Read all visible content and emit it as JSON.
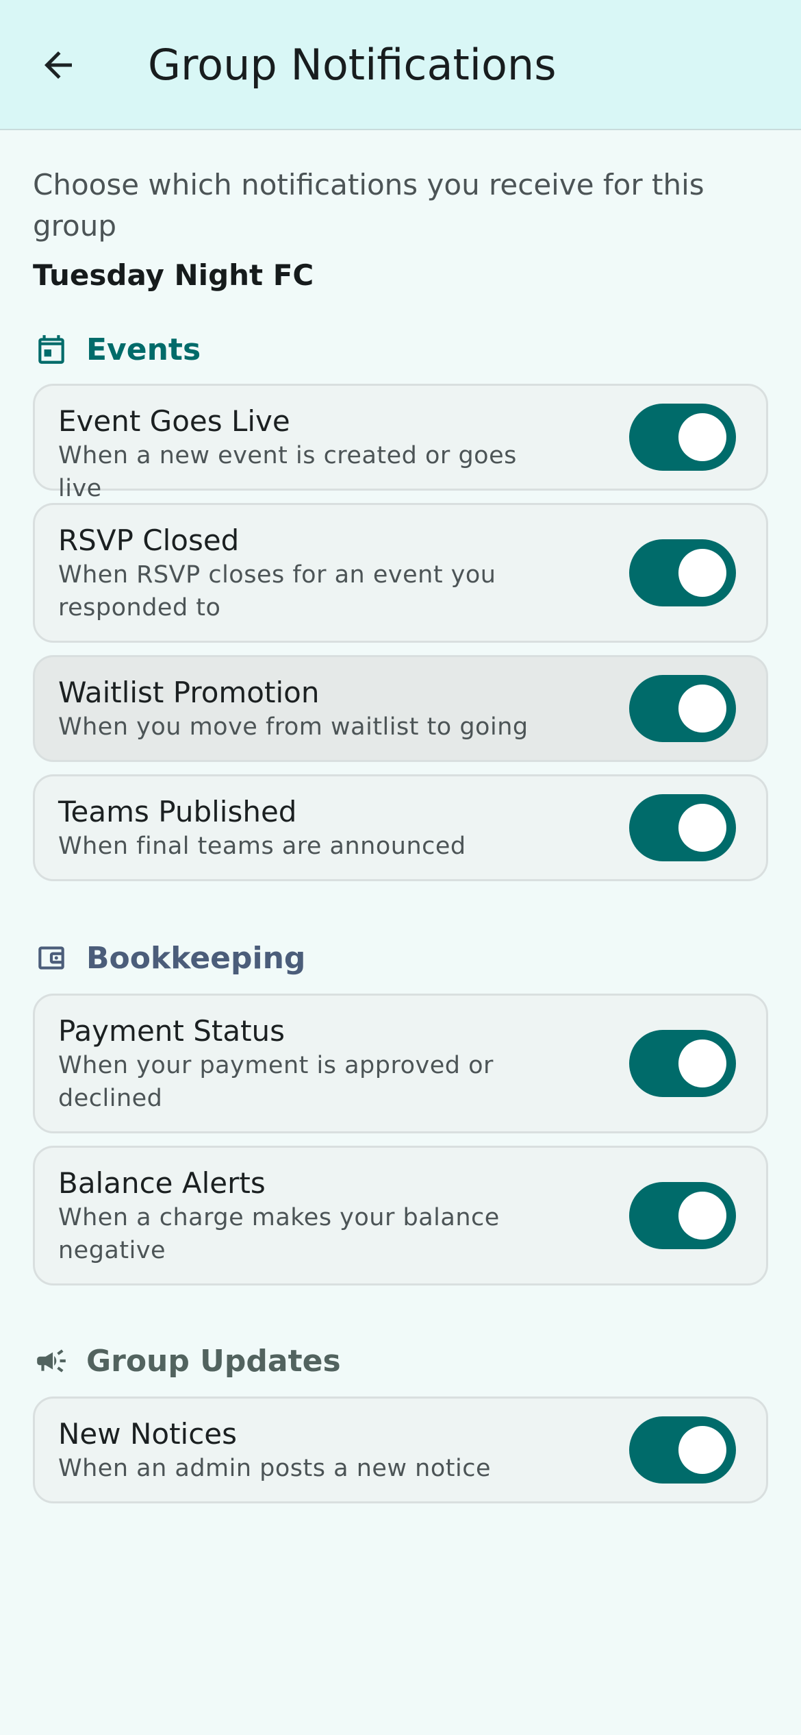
{
  "appbar": {
    "title": "Group Notifications",
    "back_icon": "arrow-left-icon"
  },
  "intro": {
    "description": "Choose which notifications you receive for this group",
    "group_name": "Tuesday Night FC"
  },
  "colors": {
    "appbar_bg": "#d9f7f6",
    "page_bg": "#f1faf9",
    "toggle_on": "#006b6a",
    "events_accent": "#016b6a",
    "bookkeeping_accent": "#4b5d7a",
    "group_updates_accent": "#52635f"
  },
  "sections": [
    {
      "label": "Events",
      "icon": "calendar-icon",
      "items": [
        {
          "title": "Event Goes Live",
          "subtitle": "When a new event is created or goes live",
          "enabled": true
        },
        {
          "title": "RSVP Closed",
          "subtitle": "When RSVP closes for an event you responded to",
          "enabled": true
        },
        {
          "title": "Waitlist Promotion",
          "subtitle": "When you move from waitlist to going",
          "enabled": true
        },
        {
          "title": "Teams Published",
          "subtitle": "When final teams are announced",
          "enabled": true
        }
      ]
    },
    {
      "label": "Bookkeeping",
      "icon": "wallet-icon",
      "items": [
        {
          "title": "Payment Status",
          "subtitle": "When your payment is approved or declined",
          "enabled": true
        },
        {
          "title": "Balance Alerts",
          "subtitle": "When a charge makes your balance negative",
          "enabled": true
        }
      ]
    },
    {
      "label": "Group Updates",
      "icon": "megaphone-icon",
      "items": [
        {
          "title": "New Notices",
          "subtitle": "When an admin posts a new notice",
          "enabled": true
        }
      ]
    }
  ]
}
